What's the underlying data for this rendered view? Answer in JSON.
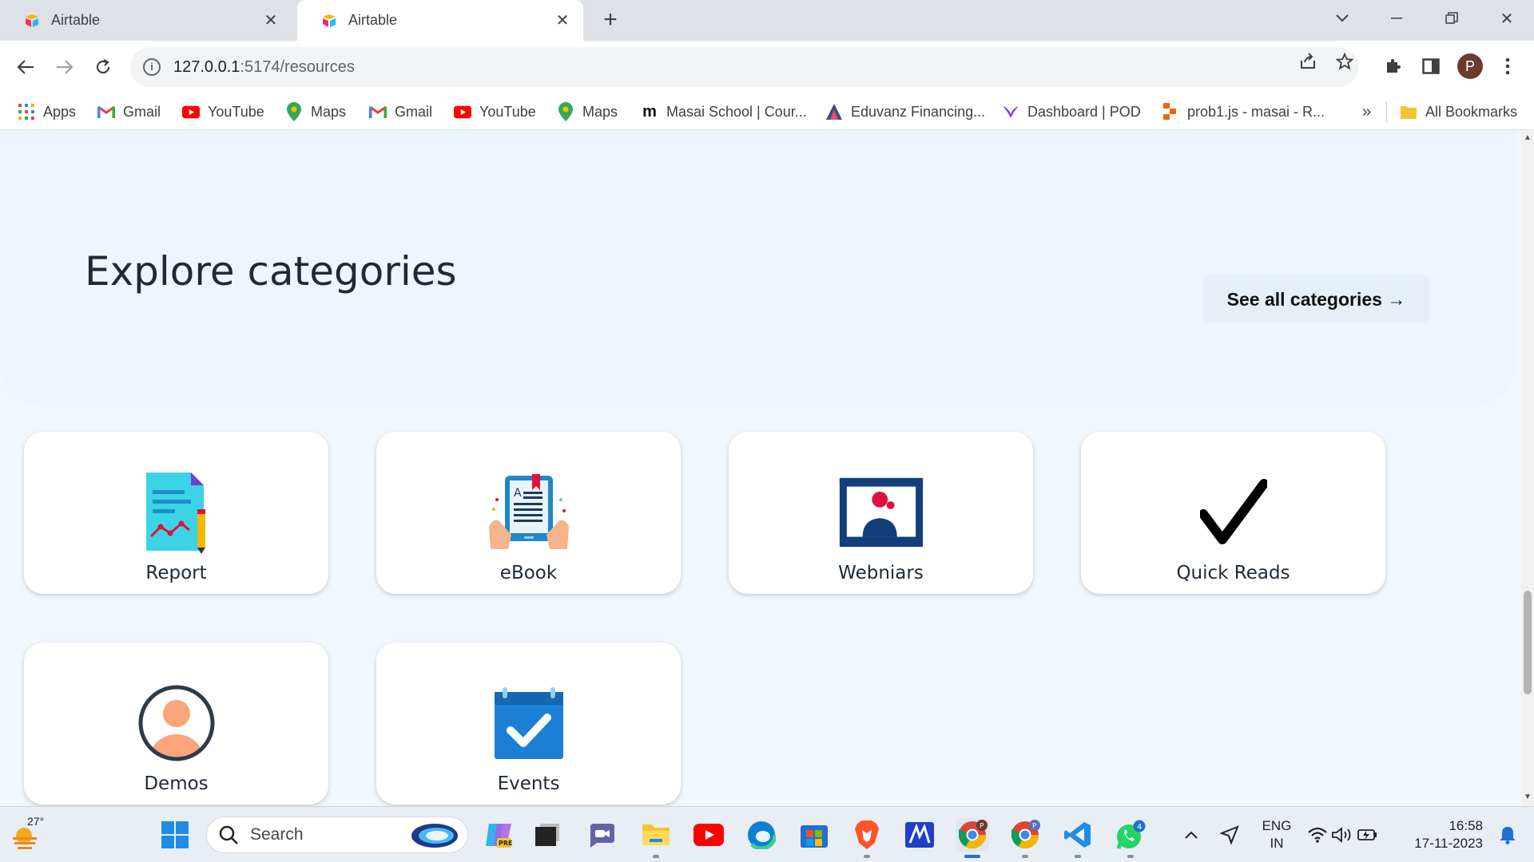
{
  "tabs": [
    {
      "title": "Airtable",
      "active": false
    },
    {
      "title": "Airtable",
      "active": true
    }
  ],
  "toolbar": {
    "url_host": "127.0.0.1",
    "url_rest": ":5174/resources",
    "profile_initial": "P"
  },
  "bookmarks": [
    {
      "label": "Apps",
      "icon": "apps-grid-icon"
    },
    {
      "label": "Gmail",
      "icon": "gmail-icon"
    },
    {
      "label": "YouTube",
      "icon": "youtube-icon"
    },
    {
      "label": "Maps",
      "icon": "maps-icon"
    },
    {
      "label": "Gmail",
      "icon": "gmail-icon"
    },
    {
      "label": "YouTube",
      "icon": "youtube-icon"
    },
    {
      "label": "Maps",
      "icon": "maps-icon"
    },
    {
      "label": "Masai School | Cour...",
      "icon": "masai-icon"
    },
    {
      "label": "Eduvanz Financing...",
      "icon": "eduvanz-icon"
    },
    {
      "label": "Dashboard | POD",
      "icon": "pod-icon"
    },
    {
      "label": "prob1.js - masai - R...",
      "icon": "replit-icon"
    },
    {
      "label": "All Bookmarks",
      "icon": "folder-icon"
    }
  ],
  "overflow": "»",
  "hero": {
    "title": "Explore categories",
    "see_all": "See all categories →"
  },
  "categories": [
    {
      "label": "Report",
      "icon": "report-icon"
    },
    {
      "label": "eBook",
      "icon": "ebook-icon"
    },
    {
      "label": "Webniars",
      "icon": "webinar-icon"
    },
    {
      "label": "Quick Reads",
      "icon": "checkmark-icon"
    },
    {
      "label": "Demos",
      "icon": "user-avatar-icon"
    },
    {
      "label": "Events",
      "icon": "calendar-check-icon"
    }
  ],
  "taskbar": {
    "weather": "27°",
    "search_placeholder": "Search",
    "lang_line1": "ENG",
    "lang_line2": "IN",
    "time": "16:58",
    "date": "17-11-2023",
    "whatsapp_badge": "4",
    "profile_badge": "P"
  },
  "colors": {
    "accent_red": "#e0103a",
    "calendar_blue": "#1b7fd6",
    "webinar_navy": "#123f7a",
    "report_cyan": "#3dd3e6",
    "demos_skin": "#f9a47a"
  }
}
